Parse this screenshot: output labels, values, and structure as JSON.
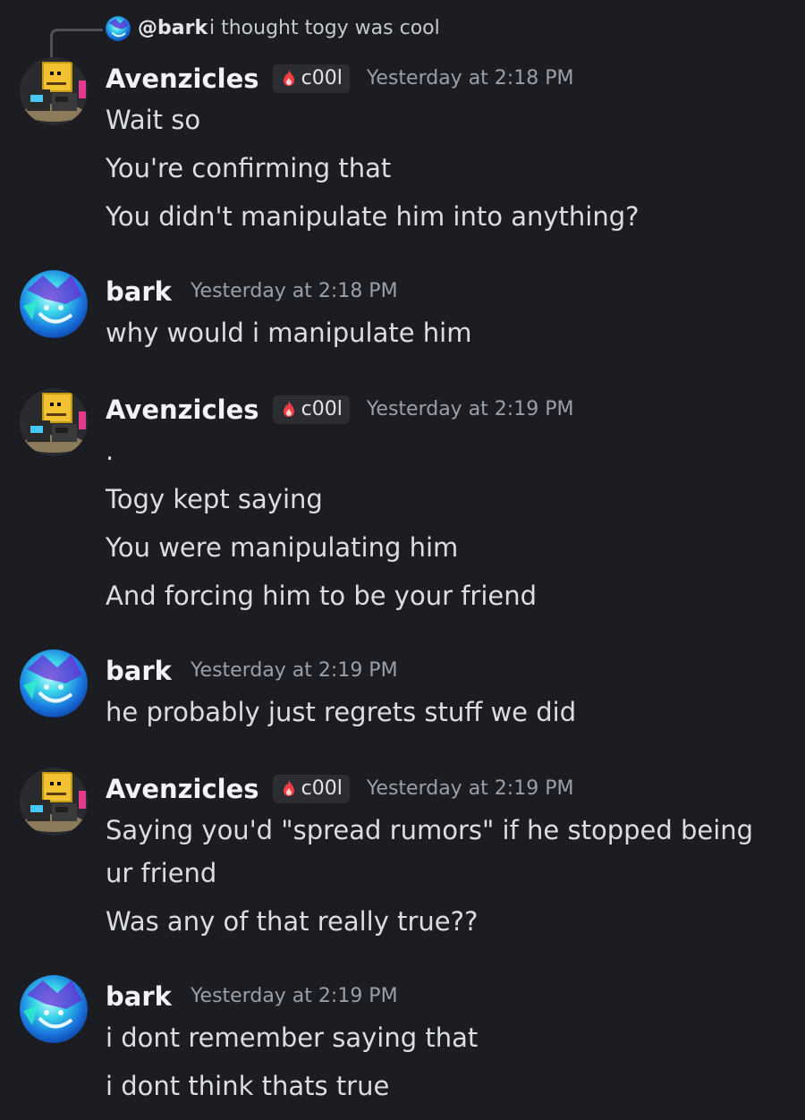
{
  "reply": {
    "author": "@bark",
    "text": "i thought togy was cool"
  },
  "messages": [
    {
      "author": "Avenzicles",
      "role": "c00l",
      "timestamp": "Yesterday at 2:18 PM",
      "lines": [
        "Wait so",
        "You're confirming that",
        "You didn't manipulate him into anything?"
      ]
    },
    {
      "author": "bark",
      "timestamp": "Yesterday at 2:18 PM",
      "lines": [
        "why would i manipulate him"
      ]
    },
    {
      "author": "Avenzicles",
      "role": "c00l",
      "timestamp": "Yesterday at 2:19 PM",
      "lines": [
        ".",
        "Togy kept saying",
        "You were manipulating him",
        "And forcing him to be your friend"
      ]
    },
    {
      "author": "bark",
      "timestamp": "Yesterday at 2:19 PM",
      "lines": [
        "he probably just regrets stuff we did"
      ]
    },
    {
      "author": "Avenzicles",
      "role": "c00l",
      "timestamp": "Yesterday at 2:19 PM",
      "lines": [
        "Saying you'd \"spread rumors\" if he stopped being ur friend",
        "Was any of that really true??"
      ]
    },
    {
      "author": "bark",
      "timestamp": "Yesterday at 2:19 PM",
      "lines": [
        "i dont remember saying that",
        "i dont think thats true"
      ]
    }
  ],
  "colors": {
    "background": "#1c1d22",
    "username": "#f2f3f5",
    "timestamp": "#9a9fa8",
    "role_badge_bg": "#2b2d33",
    "role_icon": "#f23f43"
  },
  "icons": {
    "avenzicles_avatar": "yellow-box-character-avatar",
    "bark_avatar": "blue-glitch-avatar",
    "role_icon": "flame-icon"
  }
}
